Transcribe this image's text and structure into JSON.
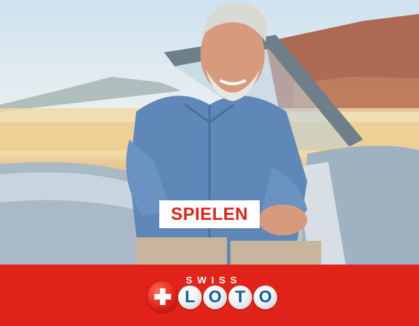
{
  "cta": {
    "label": "SPIELEN"
  },
  "brand": {
    "logo_top_text": "SWISS",
    "logo_letters": [
      "L",
      "O",
      "T",
      "O"
    ],
    "bar_color": "#e2231a",
    "letter_color": "#0a5ea8"
  },
  "icons": {
    "logo_cross": "swiss-cross-icon"
  }
}
